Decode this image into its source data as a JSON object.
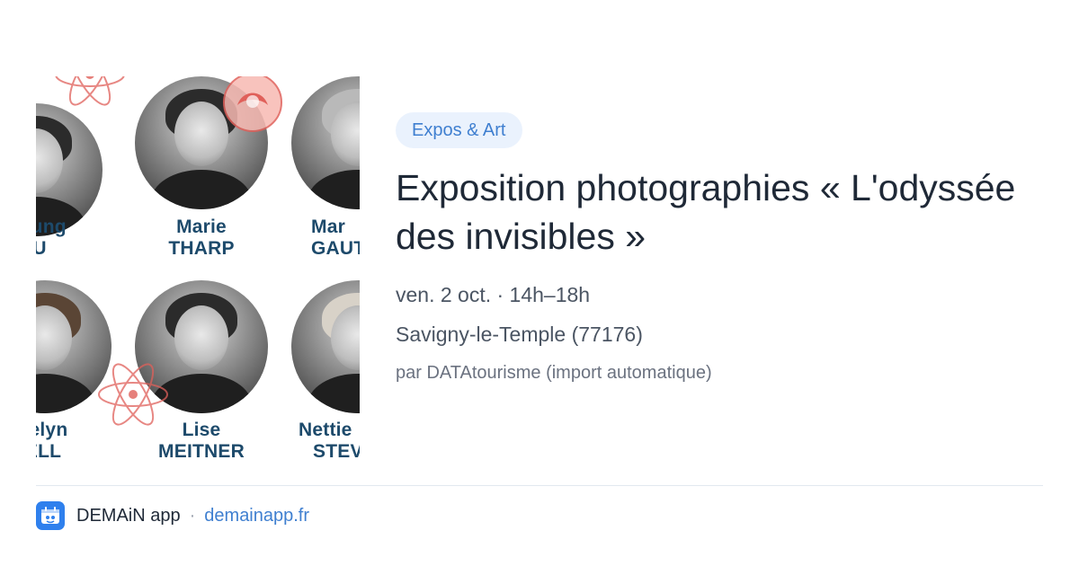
{
  "image": {
    "portraits": [
      {
        "first": "-Shiung",
        "last": "WU"
      },
      {
        "first": "Marie",
        "last": "THARP"
      },
      {
        "first": "Mar",
        "last": "GAUT"
      },
      {
        "first": "celyn",
        "last": "ELL"
      },
      {
        "first": "Lise",
        "last": "MEITNER"
      },
      {
        "first": "Nettie",
        "last": "STEV"
      }
    ],
    "name_color": "#1d4a6b",
    "atom_color": "#e0605a"
  },
  "event": {
    "category": "Expos & Art",
    "title": "Exposition photographies « L'odyssée des invisibles »",
    "date": "ven. 2 oct. · 14h–18h",
    "location": "Savigny-le-Temple (77176)",
    "source": "par DATAtourisme (import automatique)"
  },
  "footer": {
    "app_name": "DEMAiN app",
    "separator": "·",
    "link": "demainapp.fr",
    "icon": "demain-app-icon"
  },
  "colors": {
    "accent": "#3f7fd0",
    "tag_background": "#eaf2fd",
    "title": "#1f2937",
    "meta": "#4b5563"
  }
}
